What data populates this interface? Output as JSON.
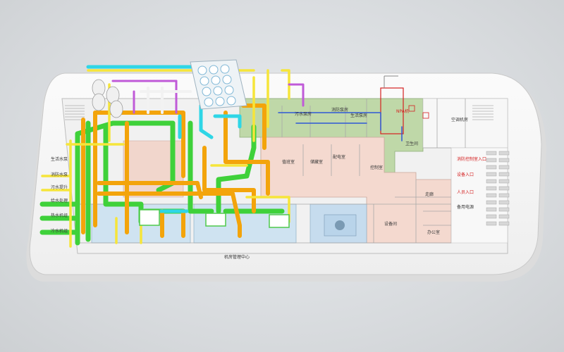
{
  "labels": {
    "bottom_label": "机房管理中心",
    "npa_label": "NPA机",
    "rooms": {
      "r1": "污水泵房",
      "r2": "消防泵房",
      "r3": "生活泵房",
      "r4": "配电室",
      "r5": "控制室",
      "r6": "值班室",
      "r7": "储藏室",
      "r8": "卫生间",
      "r9": "走廊",
      "r10": "设备间",
      "r11": "空调机房",
      "r12": "办公室"
    },
    "left_side": [
      "生活水泵",
      "消防水泵",
      "污水提升",
      "给水处理",
      "热水机组",
      "冷水机组"
    ],
    "right_entries": [
      "消防控制室入口",
      "设备入口",
      "人员入口",
      "备用电源"
    ]
  },
  "colors": {
    "green_pipe": "#3fd13a",
    "orange_pipe": "#f3a40b",
    "yellow_pipe": "#f6e53a",
    "cyan_pipe": "#2fd6e6",
    "magenta_pipe": "#c05ad8",
    "white_pipe": "#f2f2f2",
    "floor_green": "#bfd8a8",
    "floor_pink": "#f4d9cf",
    "floor_blue": "#cfe3f1",
    "platform": "#f5f5f5"
  }
}
